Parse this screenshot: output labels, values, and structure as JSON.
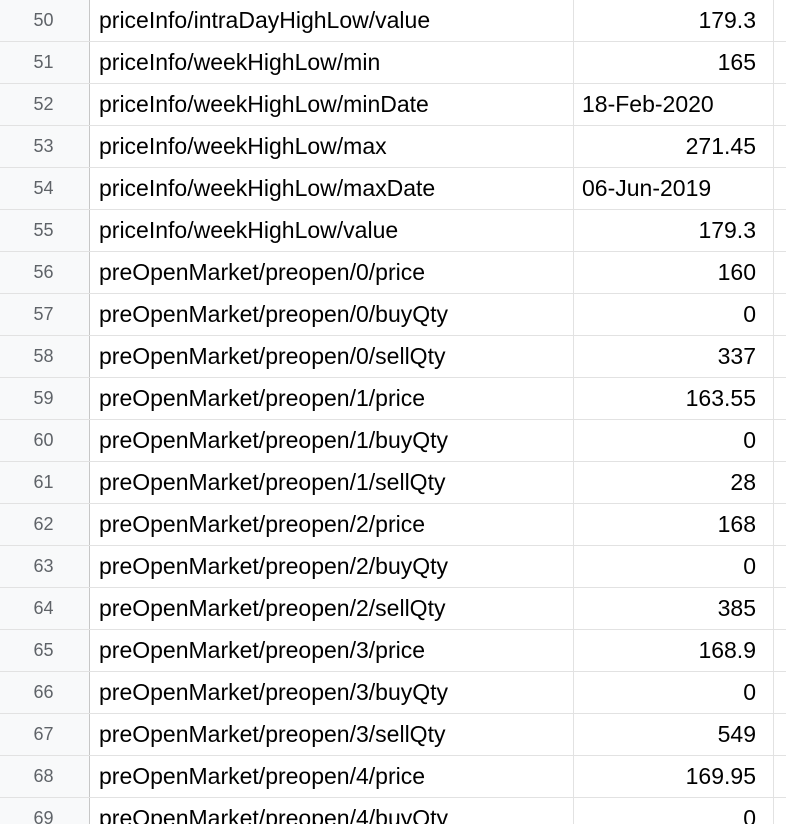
{
  "rows": [
    {
      "num": "50",
      "key": "priceInfo/intraDayHighLow/value",
      "value": "179.3",
      "align": "right"
    },
    {
      "num": "51",
      "key": "priceInfo/weekHighLow/min",
      "value": "165",
      "align": "right"
    },
    {
      "num": "52",
      "key": "priceInfo/weekHighLow/minDate",
      "value": "18-Feb-2020",
      "align": "left"
    },
    {
      "num": "53",
      "key": "priceInfo/weekHighLow/max",
      "value": "271.45",
      "align": "right"
    },
    {
      "num": "54",
      "key": "priceInfo/weekHighLow/maxDate",
      "value": "06-Jun-2019",
      "align": "left"
    },
    {
      "num": "55",
      "key": "priceInfo/weekHighLow/value",
      "value": "179.3",
      "align": "right"
    },
    {
      "num": "56",
      "key": "preOpenMarket/preopen/0/price",
      "value": "160",
      "align": "right"
    },
    {
      "num": "57",
      "key": "preOpenMarket/preopen/0/buyQty",
      "value": "0",
      "align": "right"
    },
    {
      "num": "58",
      "key": "preOpenMarket/preopen/0/sellQty",
      "value": "337",
      "align": "right"
    },
    {
      "num": "59",
      "key": "preOpenMarket/preopen/1/price",
      "value": "163.55",
      "align": "right"
    },
    {
      "num": "60",
      "key": "preOpenMarket/preopen/1/buyQty",
      "value": "0",
      "align": "right"
    },
    {
      "num": "61",
      "key": "preOpenMarket/preopen/1/sellQty",
      "value": "28",
      "align": "right"
    },
    {
      "num": "62",
      "key": "preOpenMarket/preopen/2/price",
      "value": "168",
      "align": "right"
    },
    {
      "num": "63",
      "key": "preOpenMarket/preopen/2/buyQty",
      "value": "0",
      "align": "right"
    },
    {
      "num": "64",
      "key": "preOpenMarket/preopen/2/sellQty",
      "value": "385",
      "align": "right"
    },
    {
      "num": "65",
      "key": "preOpenMarket/preopen/3/price",
      "value": "168.9",
      "align": "right"
    },
    {
      "num": "66",
      "key": "preOpenMarket/preopen/3/buyQty",
      "value": "0",
      "align": "right"
    },
    {
      "num": "67",
      "key": "preOpenMarket/preopen/3/sellQty",
      "value": "549",
      "align": "right"
    },
    {
      "num": "68",
      "key": "preOpenMarket/preopen/4/price",
      "value": "169.95",
      "align": "right"
    },
    {
      "num": "69",
      "key": "preOpenMarket/preopen/4/buyQty",
      "value": "0",
      "align": "right"
    }
  ]
}
